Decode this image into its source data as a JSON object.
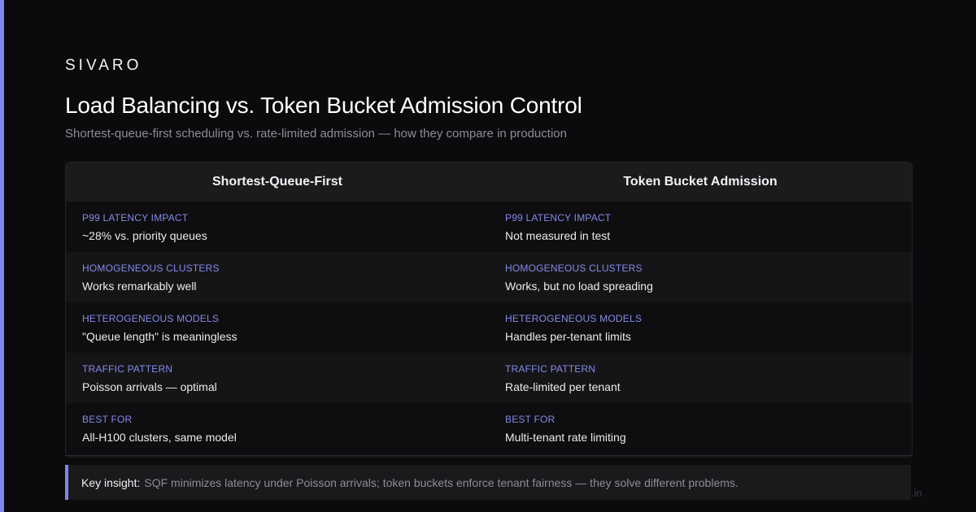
{
  "brand": "SIVARO",
  "title": "Load Balancing vs. Token Bucket Admission Control",
  "subtitle": "Shortest-queue-first scheduling vs. rate-limited admission — how they compare in production",
  "columns": [
    "Shortest-Queue-First",
    "Token Bucket Admission"
  ],
  "rows": [
    {
      "label": "P99 LATENCY IMPACT",
      "values": [
        "~28% vs. priority queues",
        "Not measured in test"
      ]
    },
    {
      "label": "HOMOGENEOUS CLUSTERS",
      "values": [
        "Works remarkably well",
        "Works, but no load spreading"
      ]
    },
    {
      "label": "HETEROGENEOUS MODELS",
      "values": [
        "\"Queue length\" is meaningless",
        "Handles per-tenant limits"
      ]
    },
    {
      "label": "TRAFFIC PATTERN",
      "values": [
        "Poisson arrivals — optimal",
        "Rate-limited per tenant"
      ]
    },
    {
      "label": "BEST FOR",
      "values": [
        "All-H100 clusters, same model",
        "Multi-tenant rate limiting"
      ]
    }
  ],
  "insight": {
    "label": "Key insight:",
    "text": "SQF minimizes latency under Poisson arrivals; token buckets enforce tenant fairness — they solve different problems."
  },
  "watermark": ".in",
  "colors": {
    "background": "#0b0b0d",
    "accent": "#7f86ec",
    "label": "#858ae8",
    "header_bg": "#1b1b1e",
    "muted_text": "#8d8d94"
  }
}
